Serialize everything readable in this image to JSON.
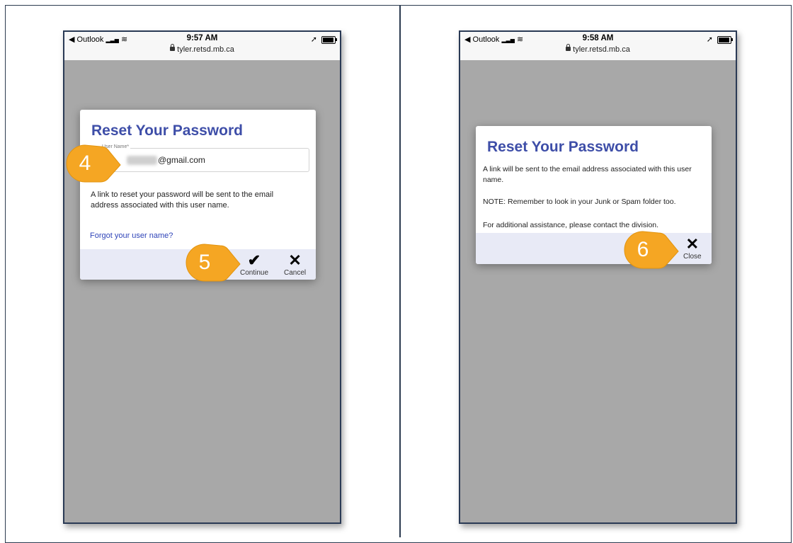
{
  "screens": [
    {
      "status": {
        "carrier": "◀ Outlook",
        "signal": "▂▃▅",
        "wifi": "≋",
        "time": "9:57 AM",
        "location": "➚",
        "url": "tyler.retsd.mb.ca"
      },
      "dialog": {
        "title": "Reset Your Password",
        "field_label": "User Name*",
        "field_value": "@gmail.com",
        "description": "A link to reset your password will be sent to the email address associated with this user name.",
        "forgot_link": "Forgot your user name?",
        "continue": {
          "glyph": "✔",
          "label": "Continue"
        },
        "cancel": {
          "glyph": "✕",
          "label": "Cancel"
        }
      }
    },
    {
      "status": {
        "carrier": "◀ Outlook",
        "signal": "▂▃▅",
        "wifi": "≋",
        "time": "9:58 AM",
        "location": "➚",
        "url": "tyler.retsd.mb.ca"
      },
      "dialog": {
        "title": "Reset Your Password",
        "line1": "A link will be sent to the email address associated with this user name.",
        "line2": "NOTE: Remember to look in your Junk or Spam folder too.",
        "line3": "For additional assistance, please contact the division.",
        "close": {
          "glyph": "✕",
          "label": "Close"
        }
      }
    }
  ],
  "callouts": [
    "4",
    "5",
    "6"
  ],
  "colors": {
    "callout": "#f5a623",
    "title": "#3e4ea8",
    "link": "#2f44b8",
    "footer": "#e8eaf6",
    "overlay": "#a8a8a8"
  }
}
